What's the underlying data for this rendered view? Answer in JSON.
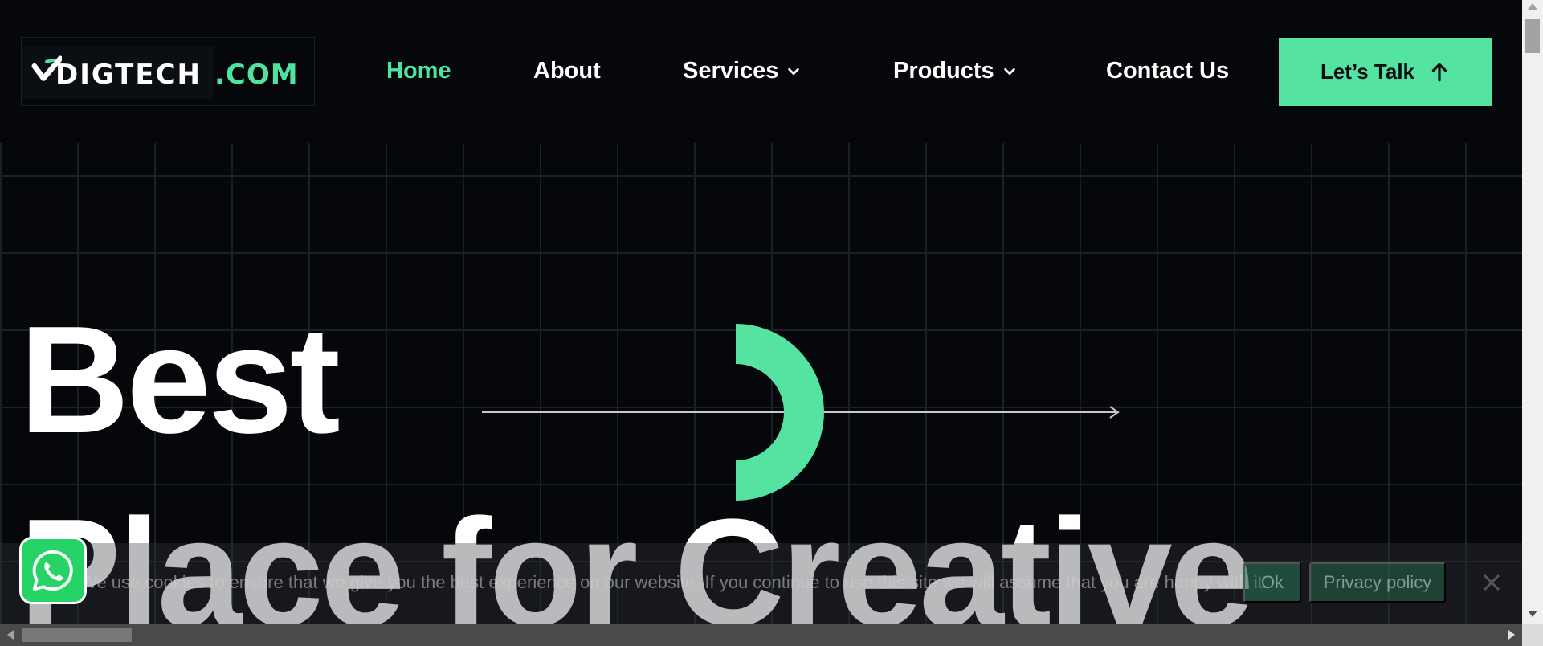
{
  "brand": {
    "name": "DIGTECH",
    "suffix": ".COM",
    "accent_color": "#55e3a2",
    "background_color": "#05070b"
  },
  "nav": {
    "items": [
      {
        "label": "Home",
        "active": true
      },
      {
        "label": "About",
        "active": false
      },
      {
        "label": "Services",
        "active": false,
        "dropdown": true
      },
      {
        "label": "Products",
        "active": false,
        "dropdown": true
      },
      {
        "label": "Contact Us",
        "active": false
      }
    ],
    "cta_label": "Let’s Talk",
    "cta_icon": "arrow-up-icon"
  },
  "hero": {
    "line1": "Best",
    "line2": "Place for Creative"
  },
  "cookie": {
    "text": "We use cookies to ensure that we give you the best experience on our website. If you continue to use this site we will assume that you are happy with it.",
    "ok_label": "Ok",
    "privacy_label": "Privacy policy"
  },
  "whatsapp": {
    "icon": "whatsapp-icon"
  }
}
